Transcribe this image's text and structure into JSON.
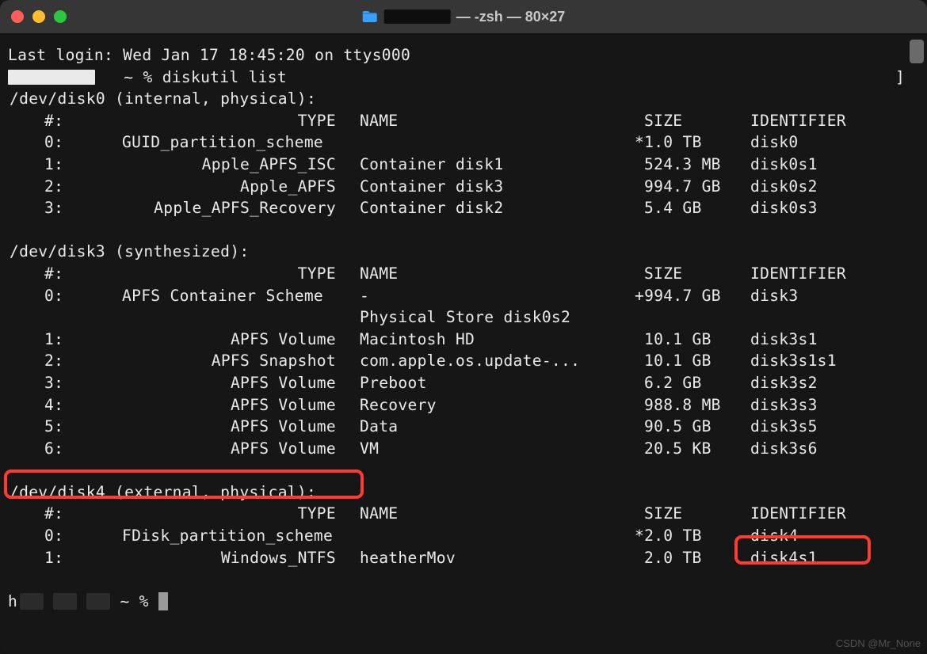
{
  "window": {
    "title_redacted": true,
    "title_suffix": " — -zsh — 80×27"
  },
  "login": {
    "prefix": "Last login: ",
    "datetime": "Wed Jan 17 18:45:20",
    "on": " on ttys000"
  },
  "prompt": {
    "tilde_percent": "~ %",
    "command": "diskutil list",
    "bracket_right": "]"
  },
  "headers": {
    "num": "#:",
    "type": "TYPE",
    "name": "NAME",
    "size": "SIZE",
    "ident": "IDENTIFIER"
  },
  "disk0": {
    "header": "/dev/disk0 (internal, physical):",
    "rows": [
      {
        "num": "0:",
        "type_left": "GUID_partition_scheme",
        "type_right": "",
        "name": "",
        "size_star": "*1.0 TB",
        "size": "",
        "ident": "disk0"
      },
      {
        "num": "1:",
        "type_left": "",
        "type_right": "Apple_APFS_ISC",
        "name": "Container disk1",
        "size": "524.3 MB",
        "ident": "disk0s1"
      },
      {
        "num": "2:",
        "type_left": "",
        "type_right": "Apple_APFS",
        "name": "Container disk3",
        "size": "994.7 GB",
        "ident": "disk0s2"
      },
      {
        "num": "3:",
        "type_left": "",
        "type_right": "Apple_APFS_Recovery",
        "name": "Container disk2",
        "size": "5.4 GB",
        "ident": "disk0s3"
      }
    ]
  },
  "disk3": {
    "header": "/dev/disk3 (synthesized):",
    "rows": [
      {
        "num": "0:",
        "type_left": "APFS Container Scheme",
        "type_right": "",
        "name": "-",
        "size_star": "+994.7 GB",
        "size": "",
        "ident": "disk3"
      },
      {
        "extra_name": "Physical Store disk0s2"
      },
      {
        "num": "1:",
        "type_right": "APFS Volume",
        "name": "Macintosh HD",
        "size": "10.1 GB",
        "ident": "disk3s1"
      },
      {
        "num": "2:",
        "type_right": "APFS Snapshot",
        "name": "com.apple.os.update-...",
        "size": "10.1 GB",
        "ident": "disk3s1s1"
      },
      {
        "num": "3:",
        "type_right": "APFS Volume",
        "name": "Preboot",
        "size": "6.2 GB",
        "ident": "disk3s2"
      },
      {
        "num": "4:",
        "type_right": "APFS Volume",
        "name": "Recovery",
        "size": "988.8 MB",
        "ident": "disk3s3"
      },
      {
        "num": "5:",
        "type_right": "APFS Volume",
        "name": "Data",
        "size": "90.5 GB",
        "ident": "disk3s5"
      },
      {
        "num": "6:",
        "type_right": "APFS Volume",
        "name": "VM",
        "size": "20.5 KB",
        "ident": "disk3s6"
      }
    ]
  },
  "disk4": {
    "header": "/dev/disk4 (external, physical):",
    "rows": [
      {
        "num": "0:",
        "type_left": "FDisk_partition_scheme",
        "type_right": "",
        "name": "",
        "size_star": "*2.0 TB",
        "size": "",
        "ident": "disk4"
      },
      {
        "num": "1:",
        "type_right": "Windows_NTFS",
        "name": "heatherMov",
        "size": "2.0 TB",
        "ident": "disk4s1"
      }
    ]
  },
  "prompt2": {
    "h": "h",
    "tilde_percent": "~ %"
  },
  "watermark": "CSDN @Mr_None"
}
